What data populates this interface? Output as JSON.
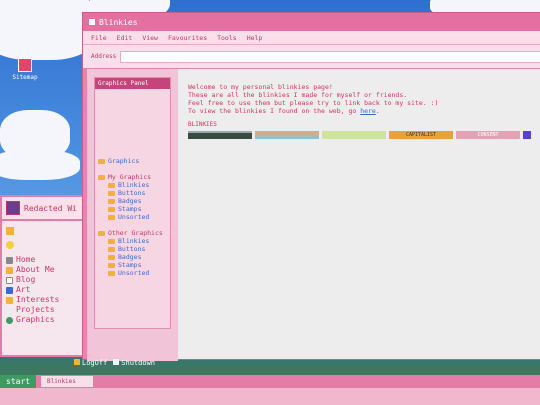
{
  "desktop": {
    "icon_label": "Sitemap"
  },
  "sidebar": {
    "title": "Redacted Wi",
    "links": [
      "Home",
      "About Me",
      "Blog",
      "Art",
      "Interests",
      "Projects",
      "Graphics"
    ]
  },
  "window": {
    "title": "Blinkies",
    "menu": [
      "File",
      "Edit",
      "View",
      "Favourites",
      "Tools",
      "Help"
    ],
    "address_label": "Address"
  },
  "panel": {
    "title": "Graphics Panel",
    "root": "Graphics",
    "my": {
      "label": "My Graphics",
      "items": [
        "Blinkies",
        "Buttons",
        "Badges",
        "Stamps",
        "Unsorted"
      ]
    },
    "other": {
      "label": "Other Graphics",
      "items": [
        "Blinkies",
        "Buttons",
        "Badges",
        "Stamps",
        "Unsorted"
      ]
    }
  },
  "main": {
    "line1": "Welcome to my personal blinkies page!",
    "line2": "These are all the blinkies I made for myself or friends.",
    "line3": "Feel free to use them but please try to link back to my site. :)",
    "line4_prefix": "To view the blinkies I found on the web, go ",
    "line4_link": "here",
    "line4_suffix": ".",
    "blinkies_label": "BLINKIES",
    "blinky_texts": [
      "CAPITALIST",
      "CONSENT"
    ]
  },
  "taskbar": {
    "start": "start",
    "task": "Blinkies",
    "logoff": "LogOff",
    "shutdown": "Shutdown"
  },
  "colors": {
    "window_pink": "#e984ad",
    "title_pink": "#e470a1",
    "link_blue": "#3d69c8",
    "text_pink": "#d23561",
    "start_green": "#3d9a62"
  }
}
